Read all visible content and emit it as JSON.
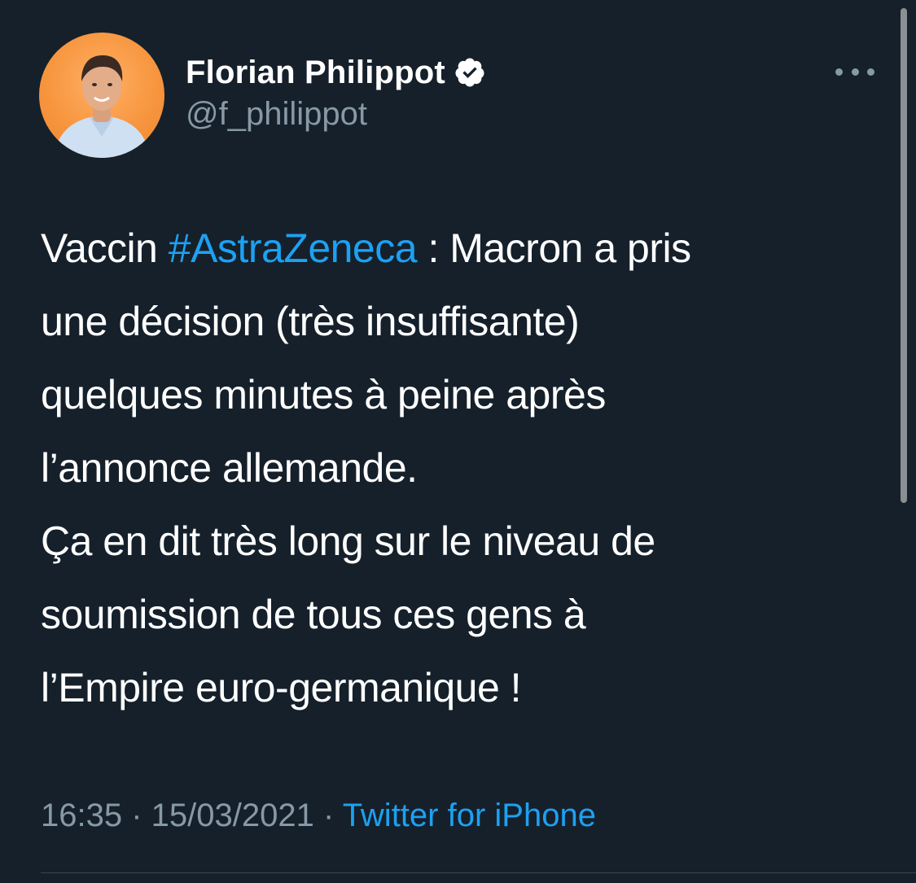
{
  "author": {
    "display_name": "Florian Philippot",
    "handle": "@f_philippot",
    "verified": true,
    "avatar_bg_color": "#f7963f"
  },
  "tweet": {
    "lines": [
      {
        "before": "Vaccin ",
        "hashtag": "#AstraZeneca",
        "after": " : Macron a pris"
      },
      "une décision (très insuffisante)",
      "quelques minutes à peine après",
      "l’annonce allemande.",
      "Ça en dit très long sur le niveau de",
      "soumission de tous ces gens à",
      "l’Empire euro-germanique !"
    ],
    "time": "16:35",
    "separator": " · ",
    "date": "15/03/2021",
    "source": "Twitter for iPhone"
  },
  "icons": {
    "verified": "verified-badge-icon",
    "more": "more-options-icon"
  },
  "colors": {
    "background": "#15202b",
    "text": "#ffffff",
    "muted": "#8899a6",
    "link": "#1da1f2"
  }
}
